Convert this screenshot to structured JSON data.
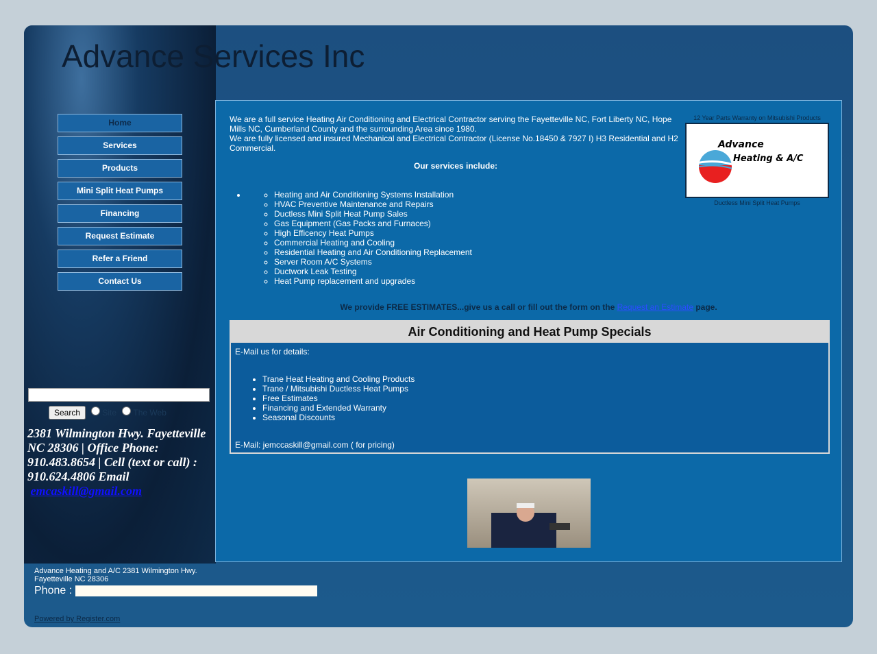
{
  "site": {
    "title": "Advance Services Inc"
  },
  "nav": [
    "Home",
    "Services",
    "Products",
    "Mini Split Heat Pumps",
    "Financing",
    "Request Estimate",
    "Refer a Friend",
    "Contact Us"
  ],
  "search": {
    "button": "Search",
    "radio1": "Site",
    "radio2": "The Web",
    "value": ""
  },
  "contact": {
    "text": "2381 Wilmington Hwy. Fayetteville NC 28306 | Office Phone: 910.483.8654 |  Cell (text or call) : 910.624.4806  Email",
    "email": "emcaskill@gmail.com"
  },
  "intro": {
    "p1": "We are a full service Heating Air Conditioning and Electrical Contractor serving the Fayetteville NC, Fort Liberty NC, Hope Mills NC, Cumberland County and the surrounding Area since 1980.",
    "p2": "We are fully licensed and insured Mechanical and Electrical Contractor (License No.18450 & 7927 I) H3 Residential and H2 Commercial.",
    "services_heading": "Our services include:"
  },
  "services": [
    "Heating and Air Conditioning  Systems Installation",
    " HVAC Preventive Maintenance and Repairs",
    "Ductless Mini Split Heat Pump Sales",
    "Gas Equipment (Gas Packs and Furnaces)",
    "High Efficency Heat Pumps",
    "Commercial Heating and Cooling",
    "Residential Heating and Air Conditioning Replacement",
    "Server Room A/C Systems",
    "Ductwork Leak Testing",
    "Heat Pump replacement and upgrades"
  ],
  "free": {
    "text": "We provide FREE ESTIMATES...give us a call or fill out the form on the ",
    "link": "Request an Estimate",
    "after": " page."
  },
  "logo": {
    "caption_top": "12 Year Parts Warranty on Mitsubishi Products",
    "line1": "Advance",
    "line2": "Heating & A/C",
    "caption_bottom": "Ductless Mini Split Heat Pumps"
  },
  "specials": {
    "title": "Air Conditioning and Heat Pump Specials",
    "intro": "E-Mail us for details:",
    "items": [
      "Trane Heat Heating and Cooling Products",
      "Trane / Mitsubishi Ductless Heat Pumps",
      "Free Estimates",
      "Financing and Extended Warranty",
      "Seasonal Discounts"
    ],
    "email": "E-Mail:  jemccaskill@gmail.com  ( for pricing)"
  },
  "footer": {
    "line1": "Advance Heating and A/C   2381 Wilmington Hwy.",
    "line2": "Fayetteville NC 28306",
    "phone_label": "Phone :",
    "powered": "Powered by Register.com"
  }
}
